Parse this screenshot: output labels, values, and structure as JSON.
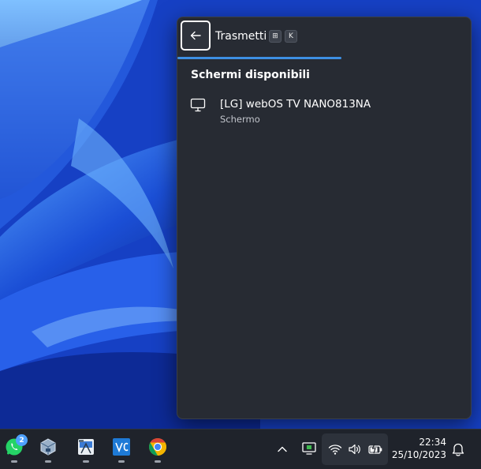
{
  "cast_panel": {
    "title": "Trasmetti",
    "shortcut_keys": [
      "⊞",
      "K"
    ],
    "progress_fraction": 0.56,
    "section_heading": "Schermi disponibili",
    "devices": [
      {
        "name": "[LG] webOS TV NANO813NA",
        "type": "Schermo",
        "icon": "monitor-icon"
      }
    ]
  },
  "taskbar": {
    "apps": [
      {
        "name": "whatsapp-icon",
        "badge": "2"
      },
      {
        "name": "virtualbox-icon"
      },
      {
        "name": "vmware-workstation-icon"
      },
      {
        "name": "visual-studio-code-icon"
      },
      {
        "name": "chrome-canary-icon"
      }
    ],
    "tray_icons": [
      "chevron-up-icon",
      "cast-tray-icon",
      "wifi-icon",
      "volume-icon",
      "battery-icon"
    ],
    "clock": {
      "time": "22:34",
      "date": "25/10/2023"
    },
    "notification_icon": "bell-icon"
  },
  "colors": {
    "accent": "#3d8fe3",
    "panel_bg": "#272b33",
    "taskbar_bg": "#1f232b",
    "wallpaper_blue": "#1a3fb8"
  }
}
